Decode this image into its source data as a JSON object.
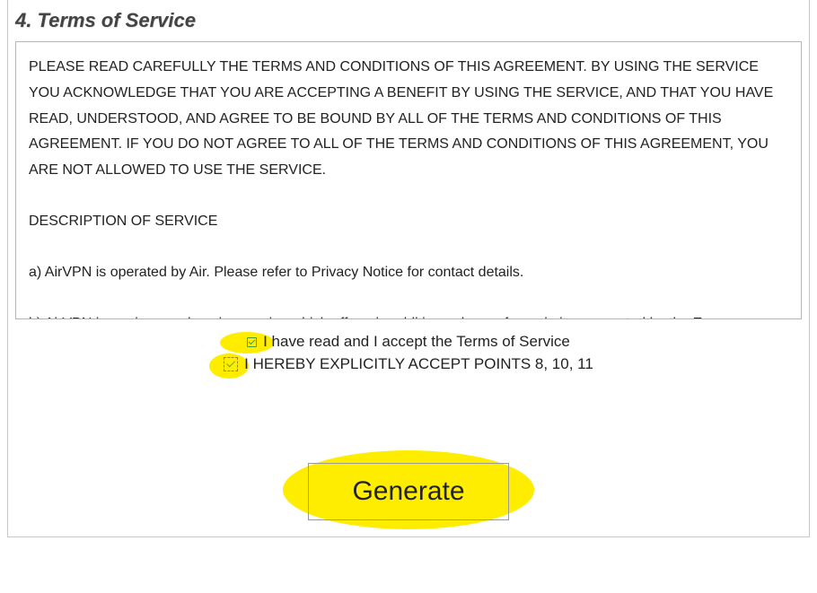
{
  "section": {
    "title": "4. Terms of Service"
  },
  "tos": {
    "p1": "PLEASE READ CAREFULLY THE TERMS AND CONDITIONS OF THIS AGREEMENT. BY USING THE SERVICE YOU ACKNOWLEDGE THAT YOU ARE ACCEPTING A BENEFIT BY USING THE SERVICE, AND THAT YOU HAVE READ, UNDERSTOOD, AND AGREE TO BE BOUND BY ALL OF THE TERMS AND CONDITIONS OF THIS AGREEMENT. IF YOU DO NOT AGREE TO ALL OF THE TERMS AND CONDITIONS OF THIS AGREEMENT, YOU ARE NOT ALLOWED TO USE THE SERVICE.",
    "p2": "DESCRIPTION OF SERVICE",
    "p3": "a) AirVPN is operated by Air. Please refer to Privacy Notice for contact details.",
    "p4": "b) AirVPN is a privacy enhancing service which offers, in addition, a layer of anonimity as granted by the European"
  },
  "checks": {
    "accept_tos_label": "I have read and I accept the Terms of Service",
    "accept_points_label": "I HEREBY EXPLICITLY ACCEPT POINTS 8, 10, 11"
  },
  "buttons": {
    "generate_label": "Generate"
  }
}
